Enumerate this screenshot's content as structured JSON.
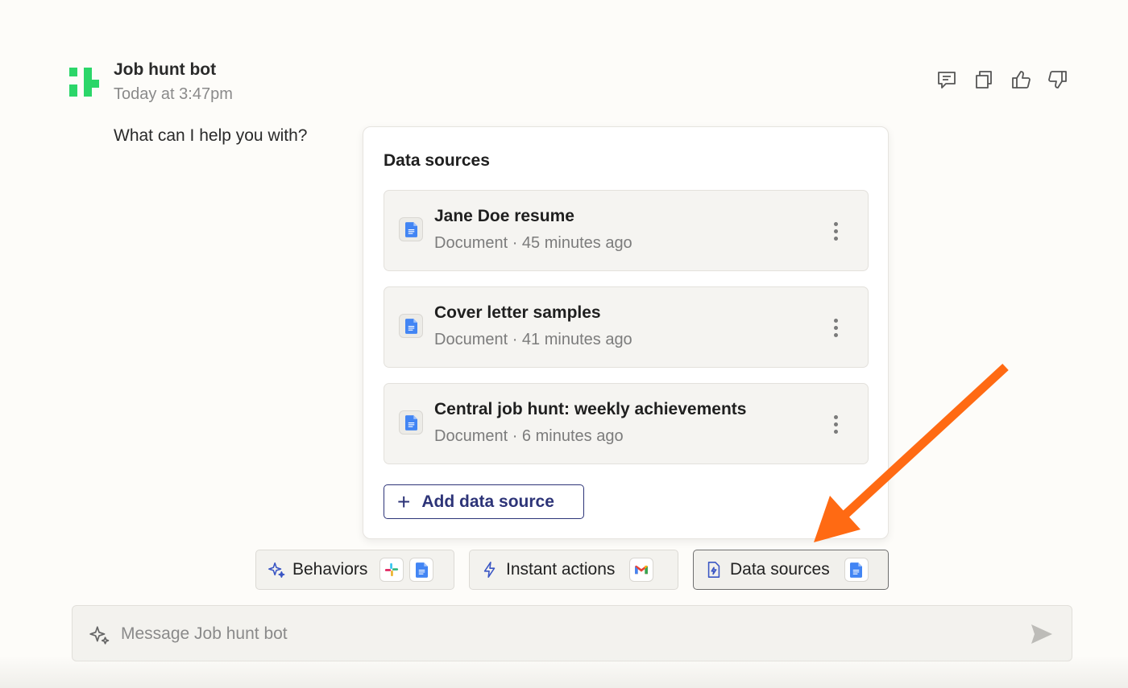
{
  "message": {
    "bot_name": "Job hunt bot",
    "timestamp": "Today at 3:47pm",
    "text": "What can I help you with?",
    "logo_icon": "zapier-agent-logo-icon",
    "logo_color": "#2bd669",
    "actions": [
      {
        "icon": "comment-icon"
      },
      {
        "icon": "copy-icon"
      },
      {
        "icon": "thumbs-up-icon"
      },
      {
        "icon": "thumbs-down-icon"
      }
    ]
  },
  "data_sources_panel": {
    "title": "Data sources",
    "items": [
      {
        "title": "Jane Doe resume",
        "meta": "Document · 45 minutes ago",
        "icon": "google-docs-icon"
      },
      {
        "title": "Cover letter samples",
        "meta": "Document · 41 minutes ago",
        "icon": "google-docs-icon"
      },
      {
        "title": "Central job hunt: weekly achievements",
        "meta": "Document · 6 minutes ago",
        "icon": "google-docs-icon"
      }
    ],
    "add_button": "Add data source"
  },
  "chips": {
    "behaviors": {
      "label": "Behaviors",
      "icon": "sparkle-icon",
      "apps": [
        "slack-icon",
        "google-docs-icon"
      ]
    },
    "instant_actions": {
      "label": "Instant actions",
      "icon": "lightning-icon",
      "apps": [
        "gmail-icon"
      ]
    },
    "data_sources": {
      "label": "Data sources",
      "icon": "file-bolt-icon",
      "apps": [
        "google-docs-icon"
      ],
      "active": true
    }
  },
  "composer": {
    "placeholder": "Message Job hunt bot",
    "icon": "sparkle-icon",
    "send_icon": "send-icon"
  },
  "annotation": {
    "icon": "orange-arrow",
    "color": "#ff6a13"
  },
  "colors": {
    "accent": "#2d3478",
    "background": "#fdfcf9",
    "docs_blue": "#4285f4"
  }
}
